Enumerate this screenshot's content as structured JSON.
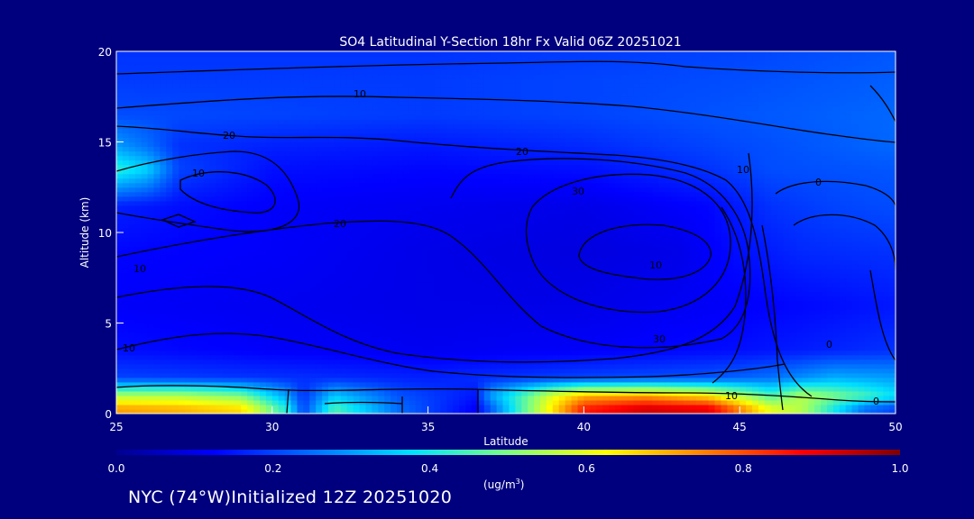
{
  "chart_data": {
    "type": "heatmap",
    "title": "SO4 Latitudinal Y-Section 18hr  Fx Valid 06Z 20251021",
    "xlabel": "Latitude",
    "ylabel": "Altitude (km)",
    "xlim": [
      25,
      50
    ],
    "ylim": [
      0,
      20
    ],
    "x_ticks": [
      "25",
      "30",
      "35",
      "40",
      "45",
      "50"
    ],
    "y_ticks": [
      "0",
      "5",
      "10",
      "15",
      "20"
    ],
    "colorbar": {
      "label_main": "(ug/m",
      "label_sup": "3",
      "label_close": ")",
      "range": [
        0.0,
        1.0
      ],
      "ticks": [
        "0.0",
        "0.2",
        "0.4",
        "0.6",
        "0.8",
        "1.0"
      ],
      "colors": [
        "#00008f",
        "#0000ff",
        "#0070ff",
        "#00e0ff",
        "#7fff80",
        "#ffff00",
        "#ff8000",
        "#ff0000",
        "#800000"
      ]
    },
    "contour_labels": [
      "10",
      "20",
      "20",
      "30",
      "10",
      "0",
      "10",
      "20",
      "30",
      "10",
      "0",
      "10",
      "10",
      "0",
      "10"
    ],
    "rows": [
      {
        "alt": 0.3,
        "values": [
          [
            25,
            0.72
          ],
          [
            27,
            0.7
          ],
          [
            29,
            0.66
          ],
          [
            30.5,
            0.4
          ],
          [
            31,
            0.2
          ],
          [
            32,
            0.45
          ],
          [
            34,
            0.25
          ],
          [
            36.5,
            0.12
          ],
          [
            37,
            0.22
          ],
          [
            38,
            0.45
          ],
          [
            39,
            0.65
          ],
          [
            40,
            0.85
          ],
          [
            42,
            0.92
          ],
          [
            44,
            0.9
          ],
          [
            46,
            0.6
          ],
          [
            47,
            0.55
          ],
          [
            49,
            0.25
          ],
          [
            50,
            0.2
          ]
        ]
      },
      {
        "alt": 1.0,
        "values": [
          [
            25,
            0.55
          ],
          [
            27,
            0.55
          ],
          [
            29,
            0.5
          ],
          [
            30.5,
            0.3
          ],
          [
            31,
            0.18
          ],
          [
            32,
            0.35
          ],
          [
            34,
            0.22
          ],
          [
            36.5,
            0.15
          ],
          [
            37,
            0.3
          ],
          [
            38,
            0.45
          ],
          [
            39,
            0.6
          ],
          [
            40,
            0.7
          ],
          [
            42,
            0.72
          ],
          [
            44,
            0.65
          ],
          [
            46,
            0.45
          ],
          [
            47,
            0.55
          ],
          [
            49,
            0.45
          ],
          [
            50,
            0.38
          ]
        ]
      },
      {
        "alt": 2.0,
        "values": [
          [
            25,
            0.2
          ],
          [
            30,
            0.18
          ],
          [
            35,
            0.16
          ],
          [
            40,
            0.2
          ],
          [
            44,
            0.22
          ],
          [
            46,
            0.25
          ],
          [
            48,
            0.32
          ],
          [
            50,
            0.3
          ]
        ]
      },
      {
        "alt": 3.5,
        "values": [
          [
            25,
            0.14
          ],
          [
            30,
            0.12
          ],
          [
            35,
            0.11
          ],
          [
            40,
            0.12
          ],
          [
            45,
            0.14
          ],
          [
            50,
            0.18
          ]
        ]
      },
      {
        "alt": 6.0,
        "values": [
          [
            25,
            0.12
          ],
          [
            30,
            0.11
          ],
          [
            35,
            0.1
          ],
          [
            40,
            0.1
          ],
          [
            45,
            0.12
          ],
          [
            50,
            0.15
          ]
        ]
      },
      {
        "alt": 9.0,
        "values": [
          [
            25,
            0.13
          ],
          [
            30,
            0.12
          ],
          [
            35,
            0.1
          ],
          [
            40,
            0.09
          ],
          [
            43,
            0.1
          ],
          [
            45,
            0.14
          ],
          [
            47,
            0.17
          ],
          [
            50,
            0.18
          ]
        ]
      },
      {
        "alt": 11.5,
        "values": [
          [
            25,
            0.16
          ],
          [
            27,
            0.14
          ],
          [
            30,
            0.12
          ],
          [
            35,
            0.11
          ],
          [
            40,
            0.1
          ],
          [
            44,
            0.13
          ],
          [
            46,
            0.18
          ],
          [
            48,
            0.2
          ],
          [
            50,
            0.21
          ]
        ]
      },
      {
        "alt": 13.5,
        "values": [
          [
            25,
            0.42
          ],
          [
            26,
            0.36
          ],
          [
            27,
            0.2
          ],
          [
            30,
            0.14
          ],
          [
            35,
            0.13
          ],
          [
            40,
            0.14
          ],
          [
            44,
            0.18
          ],
          [
            46,
            0.21
          ],
          [
            50,
            0.22
          ]
        ]
      },
      {
        "alt": 14.8,
        "values": [
          [
            25,
            0.3
          ],
          [
            26,
            0.25
          ],
          [
            27,
            0.18
          ],
          [
            30,
            0.16
          ],
          [
            35,
            0.15
          ],
          [
            40,
            0.17
          ],
          [
            44,
            0.2
          ],
          [
            47,
            0.22
          ],
          [
            50,
            0.24
          ]
        ]
      },
      {
        "alt": 16.5,
        "values": [
          [
            25,
            0.21
          ],
          [
            30,
            0.2
          ],
          [
            35,
            0.19
          ],
          [
            40,
            0.2
          ],
          [
            45,
            0.22
          ],
          [
            50,
            0.24
          ]
        ]
      },
      {
        "alt": 18.5,
        "values": [
          [
            25,
            0.19
          ],
          [
            30,
            0.19
          ],
          [
            35,
            0.19
          ],
          [
            40,
            0.2
          ],
          [
            45,
            0.21
          ],
          [
            50,
            0.23
          ]
        ]
      },
      {
        "alt": 20.0,
        "values": [
          [
            25,
            0.18
          ],
          [
            30,
            0.18
          ],
          [
            35,
            0.18
          ],
          [
            40,
            0.19
          ],
          [
            45,
            0.2
          ],
          [
            50,
            0.22
          ]
        ]
      }
    ]
  },
  "footer": "NYC (74°W)Initialized 12Z 20251020"
}
